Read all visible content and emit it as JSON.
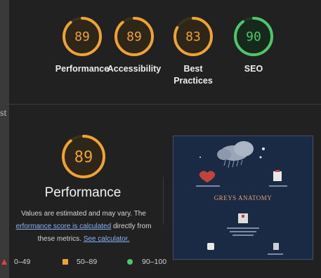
{
  "colors": {
    "orange": "#f0a232",
    "green": "#4cc76a",
    "red": "#e3423c",
    "link": "#8ab4f8",
    "panel_bg": "#212121"
  },
  "left_strip": {
    "text": "st"
  },
  "gauges": [
    {
      "value": "89",
      "label_line1": "Performance",
      "label_line2": "",
      "score": 0.89,
      "color": "#f0a232"
    },
    {
      "value": "89",
      "label_line1": "Accessibility",
      "label_line2": "",
      "score": 0.89,
      "color": "#f0a232"
    },
    {
      "value": "83",
      "label_line1": "Best",
      "label_line2": "Practices",
      "score": 0.83,
      "color": "#f0a232"
    },
    {
      "value": "90",
      "label_line1": "SEO",
      "label_line2": "",
      "score": 0.9,
      "color": "#4cc76a"
    }
  ],
  "main": {
    "value": "89",
    "score": 0.89,
    "title": "Performance",
    "desc_line1": "Values are estimated and may vary. The",
    "desc_link1": "erformance score is calculated",
    "desc_line2_rest": " directly from",
    "desc_line3": "these metrics.",
    "desc_link2": "See calculator."
  },
  "screenshot": {
    "title": "GREYS ANATOMY"
  },
  "legend": {
    "low": "0–49",
    "mid": "50–89",
    "high": "90–100"
  }
}
